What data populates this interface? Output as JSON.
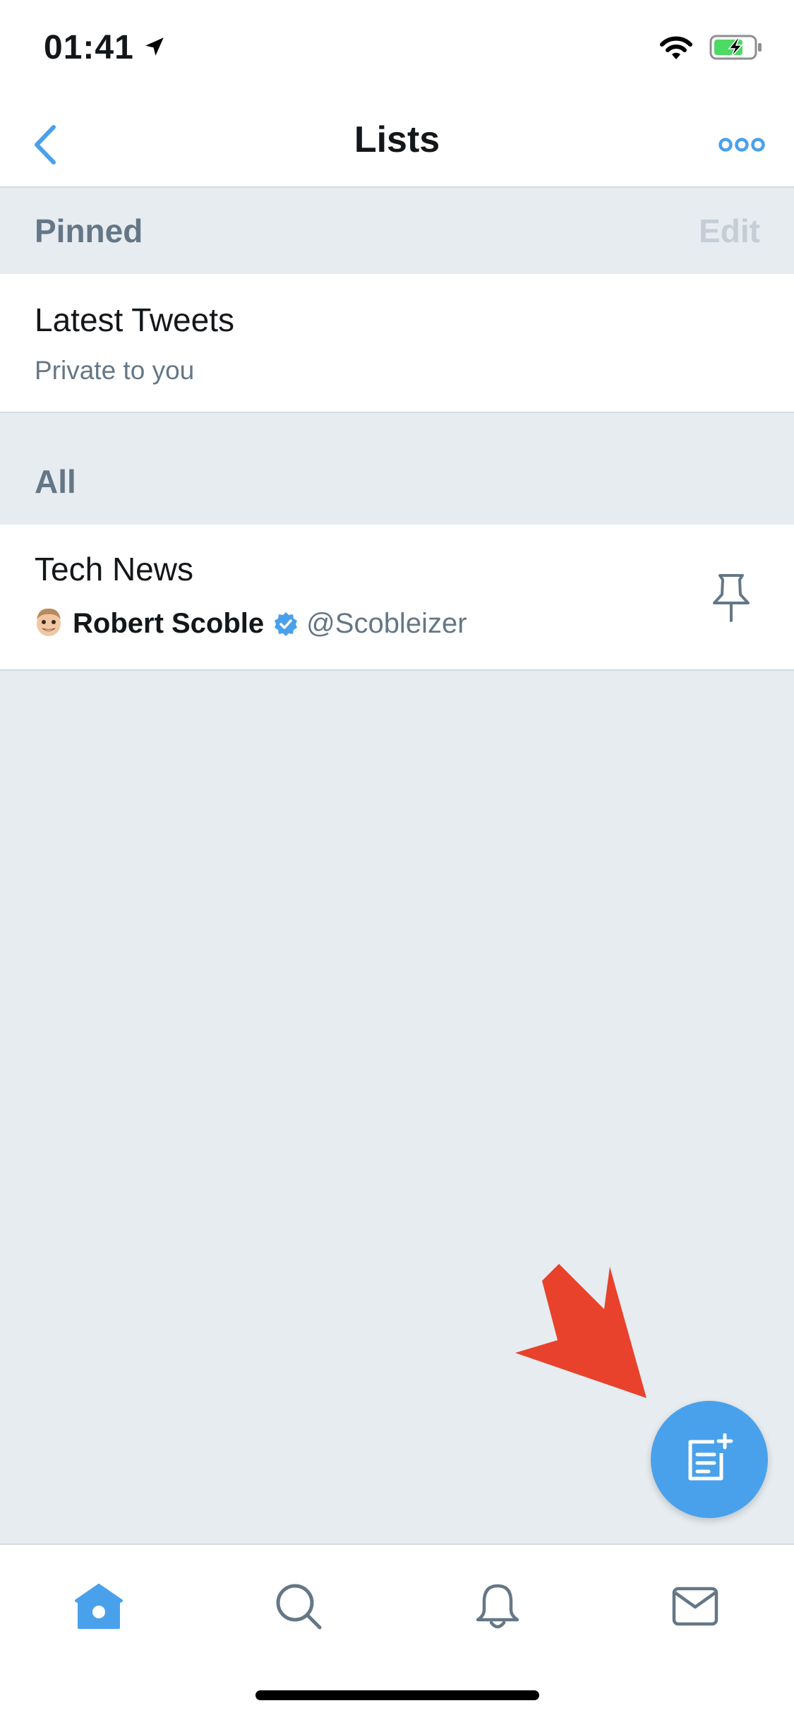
{
  "status": {
    "time": "01:41"
  },
  "header": {
    "title": "Lists"
  },
  "sections": {
    "pinned": {
      "title": "Pinned",
      "edit_label": "Edit"
    },
    "all": {
      "title": "All"
    }
  },
  "pinned_list": {
    "name": "Latest Tweets",
    "subtitle": "Private to you"
  },
  "all_lists": [
    {
      "name": "Tech News",
      "owner_name": "Robert Scoble",
      "owner_handle": "@Scobleizer",
      "owner_verified": true
    }
  ],
  "tabs": [
    {
      "name": "home",
      "icon": "home-icon",
      "active": true
    },
    {
      "name": "search",
      "icon": "search-icon",
      "active": false
    },
    {
      "name": "notifications",
      "icon": "bell-icon",
      "active": false
    },
    {
      "name": "messages",
      "icon": "mail-icon",
      "active": false
    }
  ],
  "colors": {
    "accent": "#4aa1eb",
    "background": "#e6ecf0",
    "secondary_text": "#657786",
    "arrow_annotation": "#e8412c"
  }
}
